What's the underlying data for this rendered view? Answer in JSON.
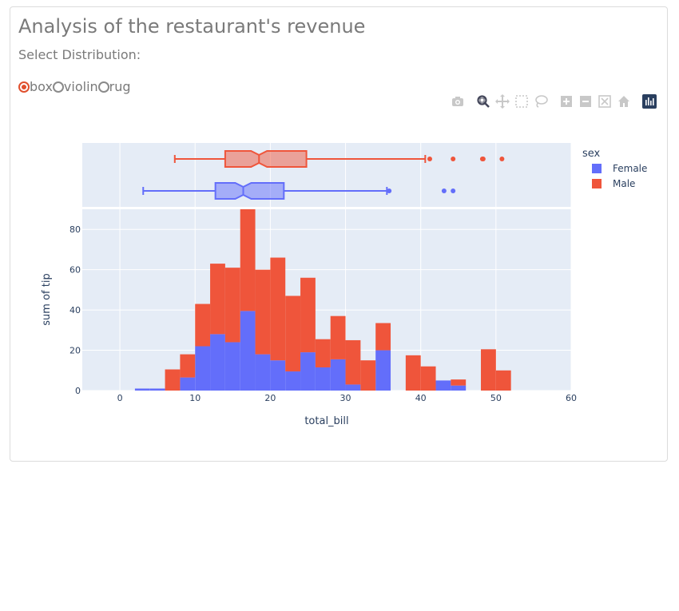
{
  "header": {
    "title": "Analysis of the restaurant's revenue",
    "select_label": "Select Distribution:"
  },
  "distribution_options": [
    {
      "label": "box",
      "selected": true
    },
    {
      "label": "violin",
      "selected": false
    },
    {
      "label": "rug",
      "selected": false
    }
  ],
  "modebar": [
    "camera-icon",
    "zoom-icon",
    "pan-icon",
    "box-select-icon",
    "lasso-select-icon",
    "zoom-in-icon",
    "zoom-out-icon",
    "autoscale-icon",
    "reset-axes-icon",
    "plotly-logo-icon"
  ],
  "colors": {
    "female": "#636efa",
    "male": "#ef553b",
    "plot_bg": "#e5ecf6",
    "accent": "#e0502e"
  },
  "chart_data": {
    "type": "bar",
    "barmode": "stack",
    "xlabel": "total_bill",
    "ylabel": "sum of tip",
    "xlim": [
      -5,
      60
    ],
    "ylim": [
      0,
      90
    ],
    "xticks": [
      0,
      10,
      20,
      30,
      40,
      50,
      60
    ],
    "yticks": [
      0,
      20,
      40,
      60,
      80
    ],
    "bin_width": 2,
    "legend": {
      "title": "sex",
      "position": "top-right"
    },
    "series": [
      {
        "name": "Female",
        "color": "#636efa",
        "bins": [
          {
            "x": 3,
            "y": 1
          },
          {
            "x": 5,
            "y": 1
          },
          {
            "x": 7,
            "y": 0
          },
          {
            "x": 9,
            "y": 6.5
          },
          {
            "x": 11,
            "y": 22
          },
          {
            "x": 13,
            "y": 28
          },
          {
            "x": 15,
            "y": 24
          },
          {
            "x": 17,
            "y": 39.5
          },
          {
            "x": 19,
            "y": 18
          },
          {
            "x": 21,
            "y": 15
          },
          {
            "x": 23,
            "y": 9.5
          },
          {
            "x": 25,
            "y": 19
          },
          {
            "x": 27,
            "y": 11.5
          },
          {
            "x": 29,
            "y": 15.5
          },
          {
            "x": 31,
            "y": 3
          },
          {
            "x": 35,
            "y": 20
          },
          {
            "x": 43,
            "y": 5
          },
          {
            "x": 45,
            "y": 2.5
          }
        ]
      },
      {
        "name": "Male",
        "color": "#ef553b",
        "bins": [
          {
            "x": 7,
            "y": 10.5
          },
          {
            "x": 9,
            "y": 11.5
          },
          {
            "x": 11,
            "y": 21
          },
          {
            "x": 13,
            "y": 35
          },
          {
            "x": 15,
            "y": 37
          },
          {
            "x": 17,
            "y": 50.5
          },
          {
            "x": 19,
            "y": 42
          },
          {
            "x": 21,
            "y": 51
          },
          {
            "x": 23,
            "y": 37.5
          },
          {
            "x": 25,
            "y": 37
          },
          {
            "x": 27,
            "y": 14
          },
          {
            "x": 29,
            "y": 21.5
          },
          {
            "x": 31,
            "y": 22
          },
          {
            "x": 33,
            "y": 15
          },
          {
            "x": 35,
            "y": 13.5
          },
          {
            "x": 39,
            "y": 17.5
          },
          {
            "x": 41,
            "y": 12
          },
          {
            "x": 45,
            "y": 3
          },
          {
            "x": 49,
            "y": 20.5
          },
          {
            "x": 51,
            "y": 10
          }
        ]
      }
    ],
    "marginal": {
      "type": "box",
      "notched": true,
      "boxes": [
        {
          "name": "Male",
          "color": "#ef553b",
          "lowerfence": 7.3,
          "q1": 14,
          "median": 18.5,
          "q3": 24.8,
          "upperfence": 40.6,
          "outliers": [
            41.2,
            44.3,
            48.2,
            48.3,
            50.8
          ]
        },
        {
          "name": "Female",
          "color": "#636efa",
          "lowerfence": 3.1,
          "q1": 12.7,
          "median": 16.4,
          "q3": 21.8,
          "upperfence": 35.5,
          "outliers": [
            35.8,
            43.1,
            44.3
          ]
        }
      ]
    }
  }
}
